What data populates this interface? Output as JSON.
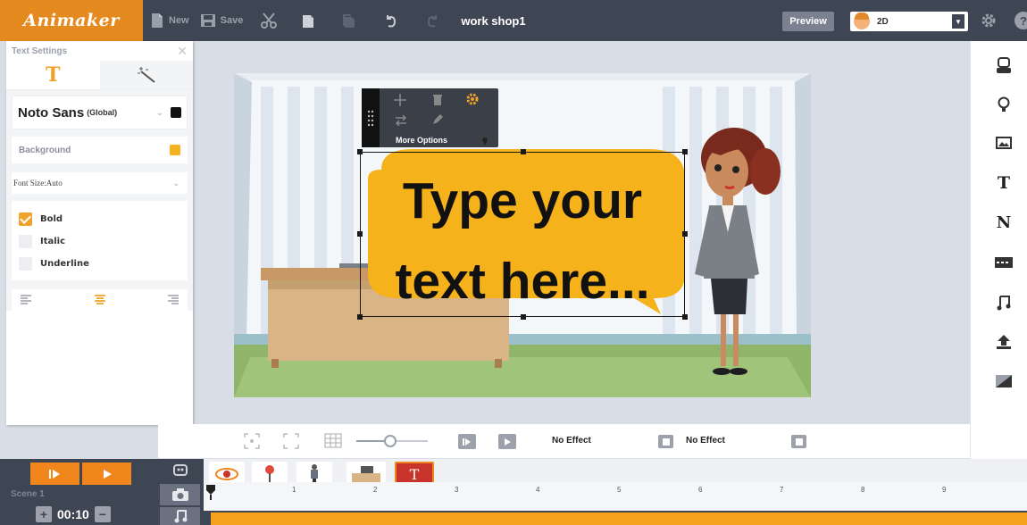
{
  "app": {
    "logo": "Animaker",
    "document_title": "work shop1"
  },
  "toolbar": {
    "new_label": "New",
    "save_label": "Save",
    "preview_label": "Preview",
    "mode_value": "2D",
    "icons": [
      "new-icon",
      "save-icon",
      "cut-icon",
      "copy-icon",
      "paste-icon",
      "undo-icon",
      "redo-icon",
      "settings-icon",
      "help-icon"
    ]
  },
  "text_settings": {
    "title": "Text Settings",
    "font_name": "Noto Sans",
    "font_scope": "(Global)",
    "font_color": "#111111",
    "background_label": "Background",
    "background_color": "#f5b323",
    "font_size_label": "Font Size:Auto",
    "styles": [
      {
        "label": "Bold",
        "checked": true
      },
      {
        "label": "Italic",
        "checked": false
      },
      {
        "label": "Underline",
        "checked": false
      }
    ],
    "alignment_selected": "center"
  },
  "canvas": {
    "bubble_line1": "Type your",
    "bubble_line2": "text here...",
    "more_options_label": "More Options",
    "bubble_color": "#f6b21b"
  },
  "controls": {
    "enter_effect": "No Effect",
    "exit_effect": "No Effect"
  },
  "timeline": {
    "scene_label": "Scene 1",
    "duration": "00:10",
    "ruler_marks": [
      "1",
      "2",
      "3",
      "4",
      "5",
      "6",
      "7",
      "8",
      "9"
    ],
    "accent_color": "#f0861c"
  }
}
